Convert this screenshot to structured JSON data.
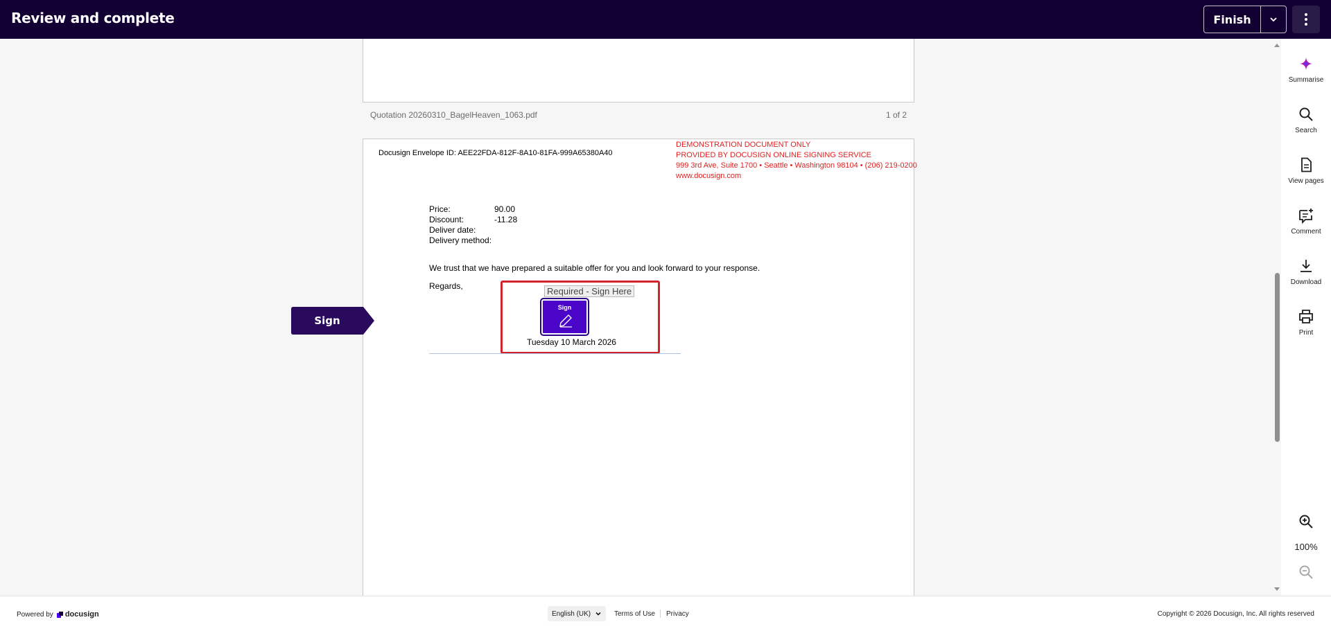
{
  "header": {
    "title": "Review and complete",
    "finish_label": "Finish"
  },
  "document": {
    "file_name": "Quotation 20260310_BagelHeaven_1063.pdf",
    "page_count": "1 of 2",
    "envelope_id": "Docusign Envelope ID: AEE22FDA-812F-8A10-81FA-999A65380A40",
    "demo_lines": [
      "DEMONSTRATION DOCUMENT ONLY",
      "PROVIDED BY DOCUSIGN ONLINE SIGNING SERVICE",
      "999 3rd Ave, Suite 1700  • Seattle • Washington 98104 • (206) 219-0200",
      "www.docusign.com"
    ],
    "fields": [
      {
        "label": "Price:",
        "value": "90.00"
      },
      {
        "label": "Discount:",
        "value": "-11.28"
      },
      {
        "label": "Deliver date:",
        "value": ""
      },
      {
        "label": "Delivery method:",
        "value": ""
      }
    ],
    "offer_text": "We trust that we have prepared a suitable offer for you and look forward to your response.",
    "regards": "Regards,",
    "required_tag": "Required - Sign Here",
    "sign_tile_label": "Sign",
    "sign_date": "Tuesday 10 March 2026",
    "sign_flag_label": "Sign"
  },
  "tools": [
    {
      "label": "Summarise",
      "icon": "sparkle-icon"
    },
    {
      "label": "Search",
      "icon": "search-icon"
    },
    {
      "label": "View pages",
      "icon": "document-icon"
    },
    {
      "label": "Comment",
      "icon": "comment-add-icon"
    },
    {
      "label": "Download",
      "icon": "download-icon"
    },
    {
      "label": "Print",
      "icon": "print-icon"
    }
  ],
  "zoom": {
    "level": "100%"
  },
  "footer": {
    "powered_by": "Powered by",
    "brand": "docusign",
    "language": "English (UK)",
    "terms": "Terms of Use",
    "privacy": "Privacy",
    "copyright": "Copyright © 2026 Docusign, Inc. All rights reserved"
  },
  "colors": {
    "header_bg": "#130032",
    "sign_tile": "#4a05c9",
    "required_border": "#d3222a",
    "demo_text": "#e02020",
    "summarise_accent": "#b41eb4"
  }
}
